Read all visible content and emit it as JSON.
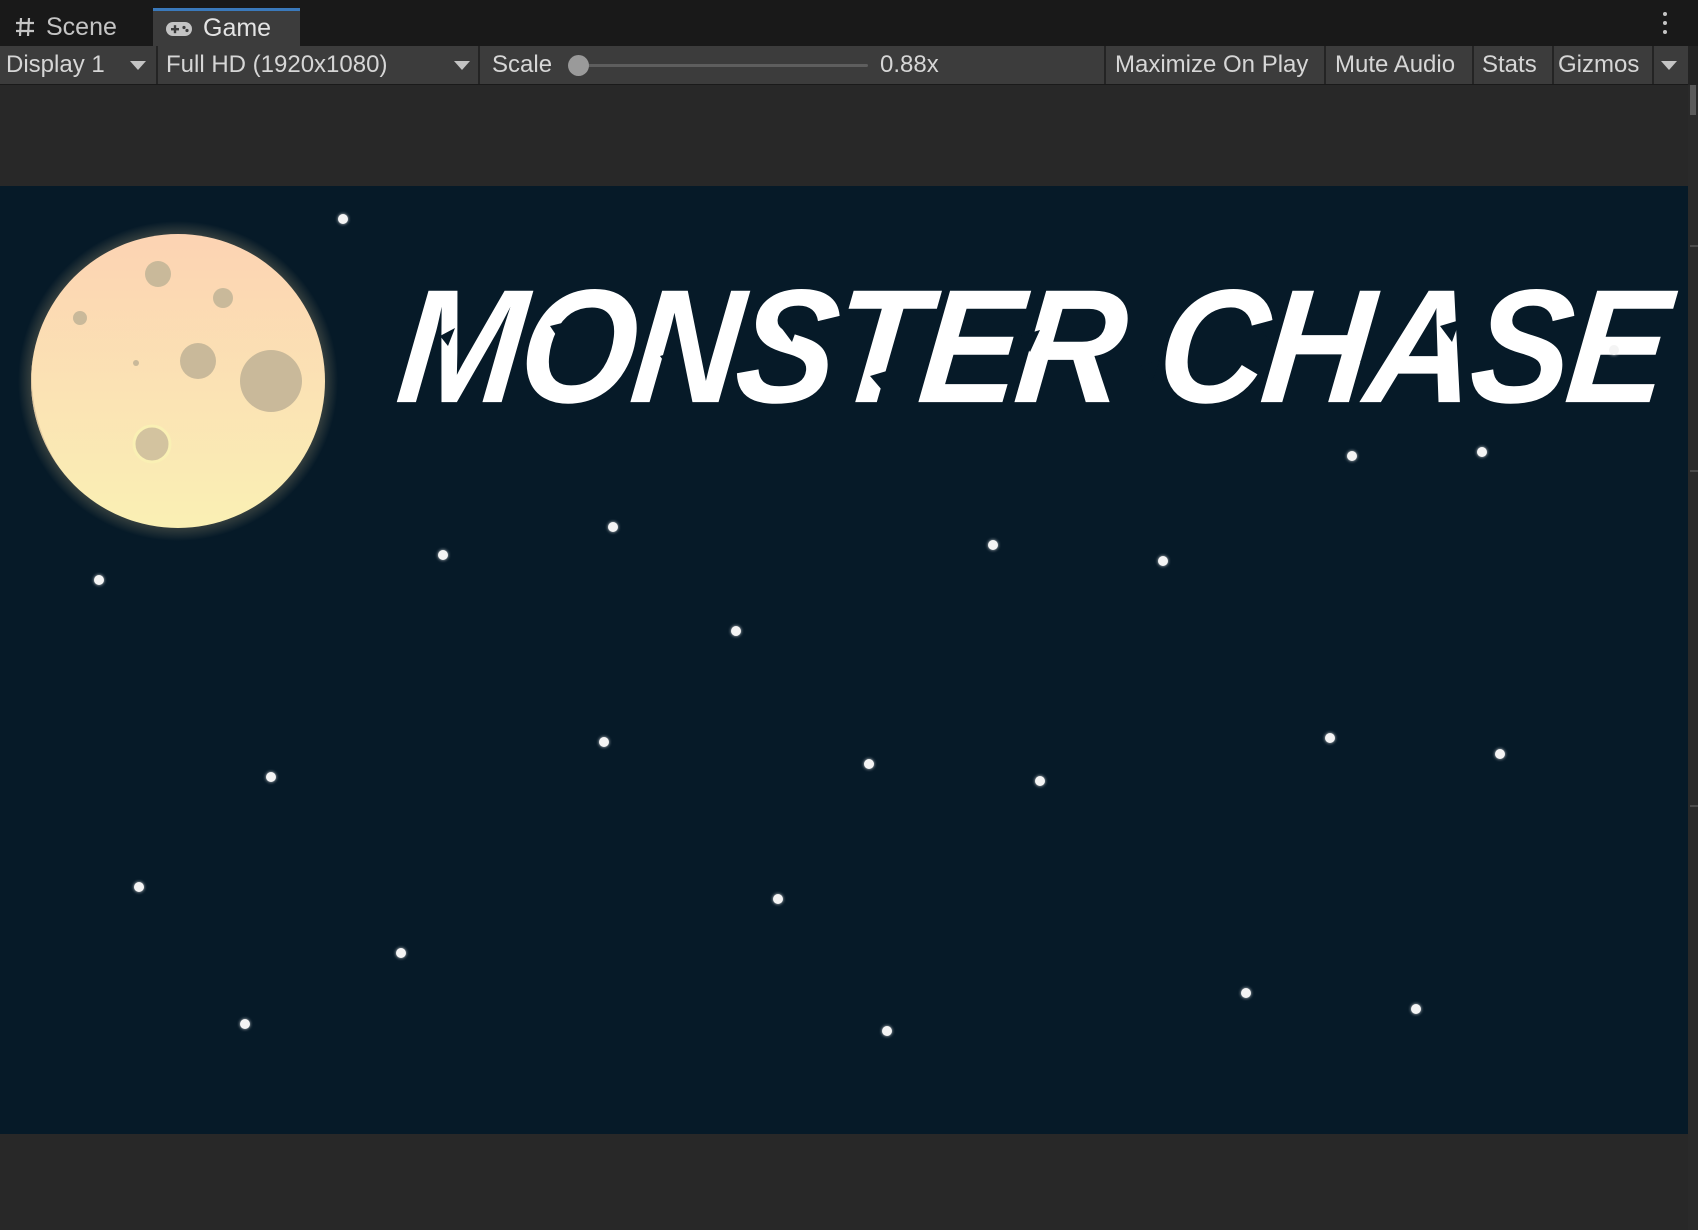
{
  "tabs": [
    {
      "label": "Scene",
      "icon": "grid-hash-icon",
      "active": false
    },
    {
      "label": "Game",
      "icon": "gamepad-icon",
      "active": true
    }
  ],
  "toolbar": {
    "display": "Display 1",
    "resolution": "Full HD (1920x1080)",
    "scale_label": "Scale",
    "scale_value": "0.88x",
    "scale_fraction": 0.0,
    "maximize_on_play": "Maximize On Play",
    "mute_audio": "Mute Audio",
    "stats": "Stats",
    "gizmos": "Gizmos"
  },
  "game": {
    "title": "MONSTER CHASE",
    "background_color": "#061a28",
    "title_color": "#ffffff",
    "moon_color": "#f7dea0"
  },
  "colors": {
    "editor_bg": "#282828",
    "tab_active_accent": "#3a79bb",
    "toolbar_bg": "#3c3c3c"
  }
}
